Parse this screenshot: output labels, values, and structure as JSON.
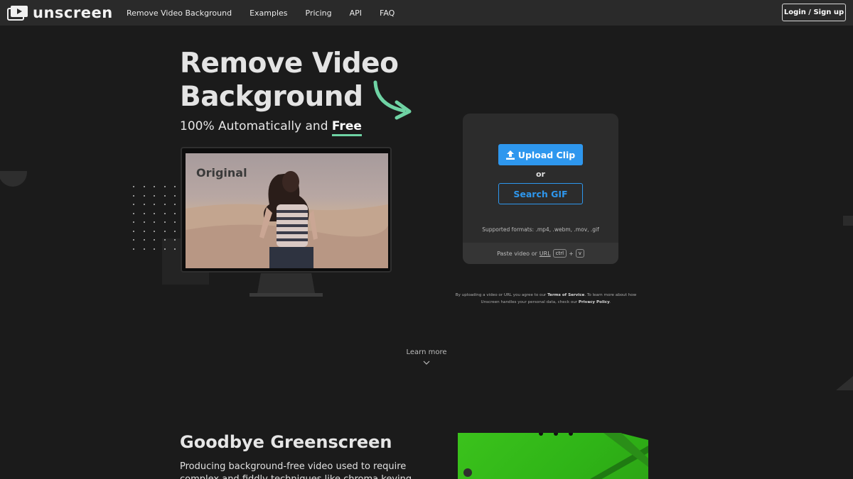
{
  "nav": {
    "logo_text": "unscreen",
    "links": [
      "Remove Video Background",
      "Examples",
      "Pricing",
      "API",
      "FAQ"
    ],
    "login_label": "Login / Sign up"
  },
  "hero": {
    "title": "Remove Video Background",
    "subtitle_prefix": "100% Automatically and",
    "subtitle_highlight": "Free",
    "preview_label": "Original"
  },
  "upload": {
    "upload_label": "Upload Clip",
    "or_label": "or",
    "gif_label": "Search GIF",
    "formats": "Supported formats: .mp4, .webm, .mov, .gif",
    "paste_prefix": "Paste video or",
    "paste_url": "URL",
    "key_ctrl": "ctrl",
    "key_plus": "+",
    "key_v": "v"
  },
  "legal": {
    "part1": "By uploading a video or URL you agree to our",
    "tos": "Terms of Service",
    "part2": ". To learn more about how Unscreen handles your personal data, check our",
    "privacy": "Privacy Policy",
    "part3": "."
  },
  "learn_more": "Learn more",
  "goodbye": {
    "title": "Goodbye Greenscreen",
    "text": "Producing background-free video used to require complex and fiddly techniques like chroma keying and"
  },
  "colors": {
    "accent_blue": "#2e97ee",
    "accent_green": "#6fd3a4",
    "background": "#1b1b1b",
    "nav_bg": "#2a2a2a"
  }
}
